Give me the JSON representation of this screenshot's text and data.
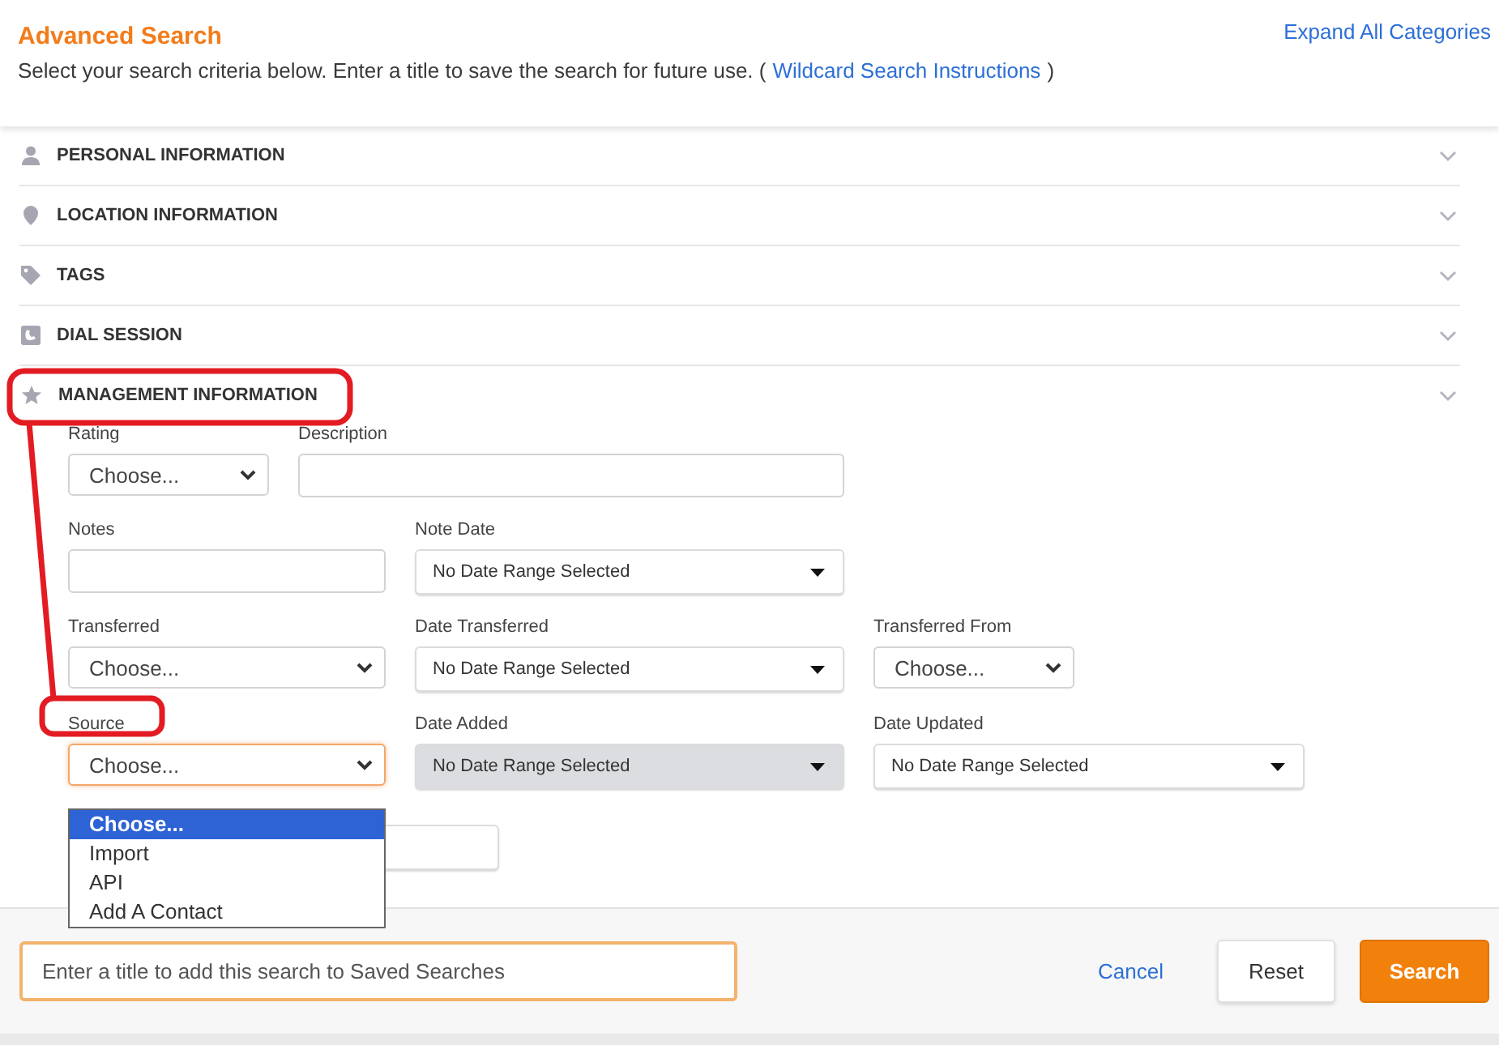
{
  "header": {
    "title": "Advanced Search",
    "subtitle": "Select your search criteria below. Enter a title to save the search for future use. (",
    "help_link": "Wildcard Search Instructions",
    "subtitle_end": ")",
    "expand_link": "Expand All Categories"
  },
  "categories": [
    {
      "label": "PERSONAL INFORMATION",
      "expanded": false
    },
    {
      "label": "LOCATION INFORMATION",
      "expanded": false
    },
    {
      "label": "TAGS",
      "expanded": false
    },
    {
      "label": "DIAL SESSION",
      "expanded": false
    },
    {
      "label": "MANAGEMENT INFORMATION",
      "expanded": true
    }
  ],
  "management_rows": [
    [
      {
        "label": "Rating",
        "kind": "select",
        "value": "Choose..."
      },
      {
        "label": "Description",
        "kind": "text"
      }
    ],
    [
      {
        "label": "Notes",
        "kind": "text"
      },
      {
        "label": "Note Date",
        "kind": "daterange",
        "value": "No Date Range Selected",
        "disabled": false
      }
    ],
    [
      {
        "label": "Transferred",
        "kind": "select",
        "value": "Choose..."
      },
      {
        "label": "Date Transferred",
        "kind": "daterange",
        "value": "No Date Range Selected",
        "disabled": false
      },
      {
        "label": "Transferred From",
        "kind": "select",
        "value": "Choose..."
      }
    ],
    [
      {
        "label": "Source",
        "kind": "select",
        "value": "Choose...",
        "focused": true
      },
      {
        "label": "Date Added",
        "kind": "daterange",
        "value": "No Date Range Selected",
        "disabled": true
      },
      {
        "label": "Date Updated",
        "kind": "daterange",
        "value": "No Date Range Selected",
        "disabled": false
      }
    ]
  ],
  "source_options": [
    {
      "label": "Choose...",
      "selected": true
    },
    {
      "label": "Import",
      "selected": false
    },
    {
      "label": "API",
      "selected": false
    },
    {
      "label": "Add A Contact",
      "selected": false
    }
  ],
  "footer": {
    "title_placeholder": "Enter a title to add this search to Saved Searches",
    "cancel": "Cancel",
    "reset": "Reset",
    "search": "Search"
  }
}
